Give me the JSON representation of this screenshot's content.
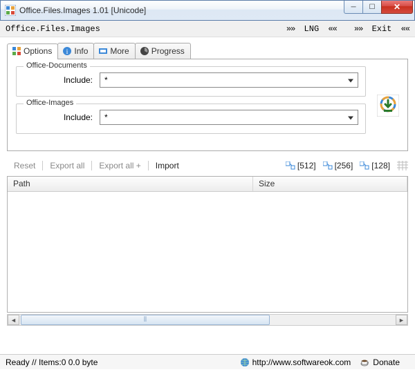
{
  "window": {
    "title": "Office.Files.Images 1.01 [Unicode]"
  },
  "header": {
    "app_name": "Office.Files.Images",
    "lng_label": "LNG",
    "exit_label": "Exit",
    "arrows_left": "»»",
    "arrows_right": "««"
  },
  "tabs": {
    "options": "Options",
    "info": "Info",
    "more": "More",
    "progress": "Progress"
  },
  "panel": {
    "docs_legend": "Office-Documents",
    "images_legend": "Office-Images",
    "include_label": "Include:",
    "docs_value": "*",
    "images_value": "*"
  },
  "actions": {
    "reset": "Reset",
    "export_all": "Export all",
    "export_all_plus": "Export all +",
    "import": "Import",
    "size512": "[512]",
    "size256": "[256]",
    "size128": "[128]"
  },
  "list": {
    "col_path": "Path",
    "col_size": "Size"
  },
  "status": {
    "text": "Ready // Items:0 0.0 byte",
    "url": "http://www.softwareok.com",
    "donate": "Donate"
  }
}
